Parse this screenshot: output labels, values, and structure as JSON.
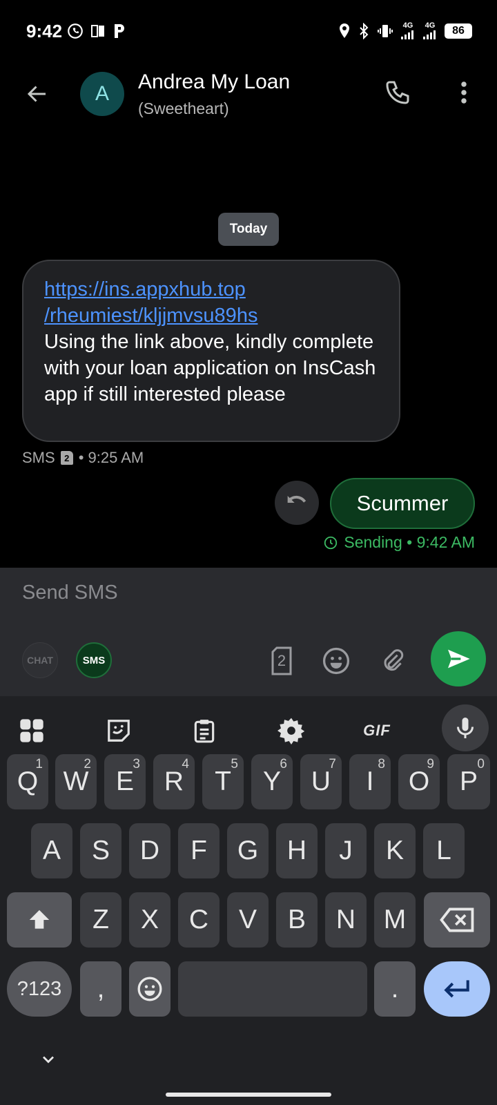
{
  "status_bar": {
    "time": "9:42",
    "network_1": "4G",
    "network_2": "4G",
    "battery": "86"
  },
  "header": {
    "avatar_letter": "A",
    "contact_name": "Andrea My Loan",
    "contact_subtitle": "(Sweetheart)"
  },
  "conversation": {
    "date_chip": "Today",
    "incoming": {
      "link_line_1": "https://ins.appxhub.top",
      "link_line_2": "/rheumiest/kljjmvsu89hs",
      "body": "Using the link above, kindly complete with your loan application on InsCash app if still interested please",
      "meta_label": "SMS",
      "meta_sim": "2",
      "meta_time": "• 9:25 AM"
    },
    "outgoing": {
      "text": "Scummer",
      "status": "Sending • 9:42 AM"
    }
  },
  "compose": {
    "placeholder": "Send SMS",
    "chat_chip": "CHAT",
    "sms_chip": "SMS",
    "sim_number": "2"
  },
  "keyboard": {
    "toolbar_gif": "GIF",
    "row1": [
      {
        "key": "Q",
        "hint": "1"
      },
      {
        "key": "W",
        "hint": "2"
      },
      {
        "key": "E",
        "hint": "3"
      },
      {
        "key": "R",
        "hint": "4"
      },
      {
        "key": "T",
        "hint": "5"
      },
      {
        "key": "Y",
        "hint": "6"
      },
      {
        "key": "U",
        "hint": "7"
      },
      {
        "key": "I",
        "hint": "8"
      },
      {
        "key": "O",
        "hint": "9"
      },
      {
        "key": "P",
        "hint": "0"
      }
    ],
    "row2": [
      "A",
      "S",
      "D",
      "F",
      "G",
      "H",
      "J",
      "K",
      "L"
    ],
    "row3": [
      "Z",
      "X",
      "C",
      "V",
      "B",
      "N",
      "M"
    ],
    "symbols_key": "?123",
    "comma_key": ",",
    "period_key": "."
  },
  "colors": {
    "accent_green": "#1e9e4f",
    "link_blue": "#4d93ff",
    "enter_key": "#a8c7fa"
  }
}
